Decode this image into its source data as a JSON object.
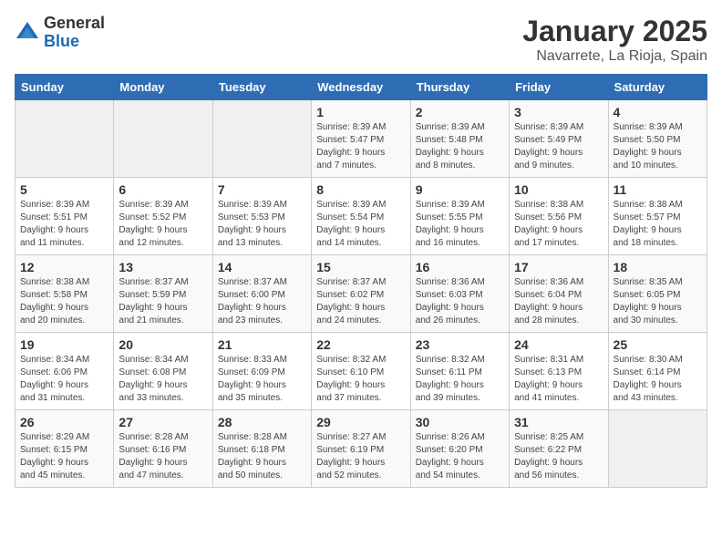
{
  "logo": {
    "general": "General",
    "blue": "Blue"
  },
  "title": "January 2025",
  "subtitle": "Navarrete, La Rioja, Spain",
  "weekdays": [
    "Sunday",
    "Monday",
    "Tuesday",
    "Wednesday",
    "Thursday",
    "Friday",
    "Saturday"
  ],
  "weeks": [
    [
      {
        "day": "",
        "info": ""
      },
      {
        "day": "",
        "info": ""
      },
      {
        "day": "",
        "info": ""
      },
      {
        "day": "1",
        "info": "Sunrise: 8:39 AM\nSunset: 5:47 PM\nDaylight: 9 hours\nand 7 minutes."
      },
      {
        "day": "2",
        "info": "Sunrise: 8:39 AM\nSunset: 5:48 PM\nDaylight: 9 hours\nand 8 minutes."
      },
      {
        "day": "3",
        "info": "Sunrise: 8:39 AM\nSunset: 5:49 PM\nDaylight: 9 hours\nand 9 minutes."
      },
      {
        "day": "4",
        "info": "Sunrise: 8:39 AM\nSunset: 5:50 PM\nDaylight: 9 hours\nand 10 minutes."
      }
    ],
    [
      {
        "day": "5",
        "info": "Sunrise: 8:39 AM\nSunset: 5:51 PM\nDaylight: 9 hours\nand 11 minutes."
      },
      {
        "day": "6",
        "info": "Sunrise: 8:39 AM\nSunset: 5:52 PM\nDaylight: 9 hours\nand 12 minutes."
      },
      {
        "day": "7",
        "info": "Sunrise: 8:39 AM\nSunset: 5:53 PM\nDaylight: 9 hours\nand 13 minutes."
      },
      {
        "day": "8",
        "info": "Sunrise: 8:39 AM\nSunset: 5:54 PM\nDaylight: 9 hours\nand 14 minutes."
      },
      {
        "day": "9",
        "info": "Sunrise: 8:39 AM\nSunset: 5:55 PM\nDaylight: 9 hours\nand 16 minutes."
      },
      {
        "day": "10",
        "info": "Sunrise: 8:38 AM\nSunset: 5:56 PM\nDaylight: 9 hours\nand 17 minutes."
      },
      {
        "day": "11",
        "info": "Sunrise: 8:38 AM\nSunset: 5:57 PM\nDaylight: 9 hours\nand 18 minutes."
      }
    ],
    [
      {
        "day": "12",
        "info": "Sunrise: 8:38 AM\nSunset: 5:58 PM\nDaylight: 9 hours\nand 20 minutes."
      },
      {
        "day": "13",
        "info": "Sunrise: 8:37 AM\nSunset: 5:59 PM\nDaylight: 9 hours\nand 21 minutes."
      },
      {
        "day": "14",
        "info": "Sunrise: 8:37 AM\nSunset: 6:00 PM\nDaylight: 9 hours\nand 23 minutes."
      },
      {
        "day": "15",
        "info": "Sunrise: 8:37 AM\nSunset: 6:02 PM\nDaylight: 9 hours\nand 24 minutes."
      },
      {
        "day": "16",
        "info": "Sunrise: 8:36 AM\nSunset: 6:03 PM\nDaylight: 9 hours\nand 26 minutes."
      },
      {
        "day": "17",
        "info": "Sunrise: 8:36 AM\nSunset: 6:04 PM\nDaylight: 9 hours\nand 28 minutes."
      },
      {
        "day": "18",
        "info": "Sunrise: 8:35 AM\nSunset: 6:05 PM\nDaylight: 9 hours\nand 30 minutes."
      }
    ],
    [
      {
        "day": "19",
        "info": "Sunrise: 8:34 AM\nSunset: 6:06 PM\nDaylight: 9 hours\nand 31 minutes."
      },
      {
        "day": "20",
        "info": "Sunrise: 8:34 AM\nSunset: 6:08 PM\nDaylight: 9 hours\nand 33 minutes."
      },
      {
        "day": "21",
        "info": "Sunrise: 8:33 AM\nSunset: 6:09 PM\nDaylight: 9 hours\nand 35 minutes."
      },
      {
        "day": "22",
        "info": "Sunrise: 8:32 AM\nSunset: 6:10 PM\nDaylight: 9 hours\nand 37 minutes."
      },
      {
        "day": "23",
        "info": "Sunrise: 8:32 AM\nSunset: 6:11 PM\nDaylight: 9 hours\nand 39 minutes."
      },
      {
        "day": "24",
        "info": "Sunrise: 8:31 AM\nSunset: 6:13 PM\nDaylight: 9 hours\nand 41 minutes."
      },
      {
        "day": "25",
        "info": "Sunrise: 8:30 AM\nSunset: 6:14 PM\nDaylight: 9 hours\nand 43 minutes."
      }
    ],
    [
      {
        "day": "26",
        "info": "Sunrise: 8:29 AM\nSunset: 6:15 PM\nDaylight: 9 hours\nand 45 minutes."
      },
      {
        "day": "27",
        "info": "Sunrise: 8:28 AM\nSunset: 6:16 PM\nDaylight: 9 hours\nand 47 minutes."
      },
      {
        "day": "28",
        "info": "Sunrise: 8:28 AM\nSunset: 6:18 PM\nDaylight: 9 hours\nand 50 minutes."
      },
      {
        "day": "29",
        "info": "Sunrise: 8:27 AM\nSunset: 6:19 PM\nDaylight: 9 hours\nand 52 minutes."
      },
      {
        "day": "30",
        "info": "Sunrise: 8:26 AM\nSunset: 6:20 PM\nDaylight: 9 hours\nand 54 minutes."
      },
      {
        "day": "31",
        "info": "Sunrise: 8:25 AM\nSunset: 6:22 PM\nDaylight: 9 hours\nand 56 minutes."
      },
      {
        "day": "",
        "info": ""
      }
    ]
  ]
}
